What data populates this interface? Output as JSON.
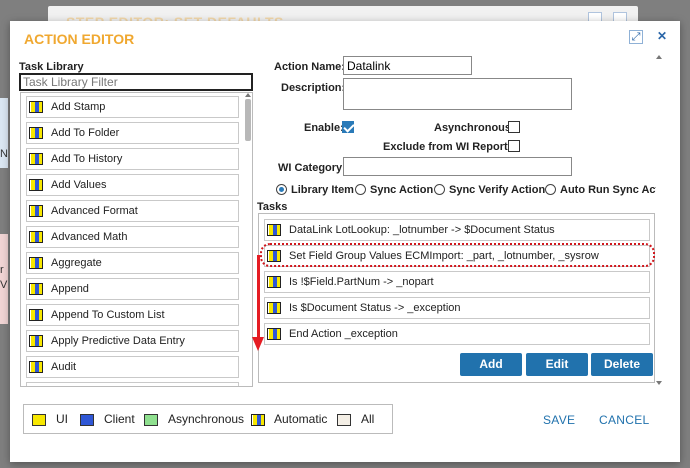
{
  "background": {
    "title": "STEP EDITOR: SET DEFAULTS",
    "side_text": [
      "N",
      "r",
      "V"
    ]
  },
  "dialog": {
    "title": "ACTION EDITOR",
    "maximize_label": "⤢",
    "close_label": "✕"
  },
  "task_library": {
    "label": "Task Library",
    "filter_placeholder": "Task Library Filter",
    "filter_value": "",
    "items": [
      {
        "label": "Add Stamp"
      },
      {
        "label": "Add To Folder"
      },
      {
        "label": "Add To History"
      },
      {
        "label": "Add Values"
      },
      {
        "label": "Advanced Format"
      },
      {
        "label": "Advanced Math"
      },
      {
        "label": "Aggregate"
      },
      {
        "label": "Append"
      },
      {
        "label": "Append To Custom List"
      },
      {
        "label": "Apply Predictive Data Entry"
      },
      {
        "label": "Audit"
      }
    ]
  },
  "form": {
    "action_name_label": "Action Name:",
    "action_name_value": "Datalink",
    "description_label": "Description:",
    "description_value": "",
    "enable_label": "Enable:",
    "enable_checked": true,
    "asynchronous_label": "Asynchronous:",
    "asynchronous_checked": false,
    "exclude_label": "Exclude from WI Reports:",
    "exclude_checked": false,
    "wi_category_label": "WI Category:",
    "wi_category_value": "",
    "radio_options": [
      {
        "label": "Library Item",
        "selected": true
      },
      {
        "label": "Sync Action",
        "selected": false
      },
      {
        "label": "Sync Verify Action",
        "selected": false
      },
      {
        "label": "Auto Run Sync Actio",
        "selected": false
      }
    ]
  },
  "tasks": {
    "label": "Tasks",
    "items": [
      {
        "label": "DataLink LotLookup: _lotnumber -> $Document Status"
      },
      {
        "label": "Set Field Group Values ECMImport: _part, _lotnumber, _sysrow"
      },
      {
        "label": "Is !$Field.PartNum -> _nopart"
      },
      {
        "label": "Is $Document Status -> _exception"
      },
      {
        "label": "End Action _exception"
      }
    ],
    "highlighted_index": 1
  },
  "buttons": {
    "add": "Add",
    "edit": "Edit",
    "delete": "Delete",
    "save": "SAVE",
    "cancel": "CANCEL"
  },
  "legend": [
    {
      "label": "UI",
      "color": "#f7e700"
    },
    {
      "label": "Client",
      "color": "#2f57d6"
    },
    {
      "label": "Asynchronous",
      "color": "#8fe08f"
    },
    {
      "label": "Automatic",
      "color": "mixed"
    },
    {
      "label": "All",
      "color": "#f4efe6"
    }
  ],
  "colors": {
    "accent": "#f0a830",
    "primary_button": "#2172ad",
    "highlight": "#d0161c",
    "arrow": "#e51c23"
  }
}
